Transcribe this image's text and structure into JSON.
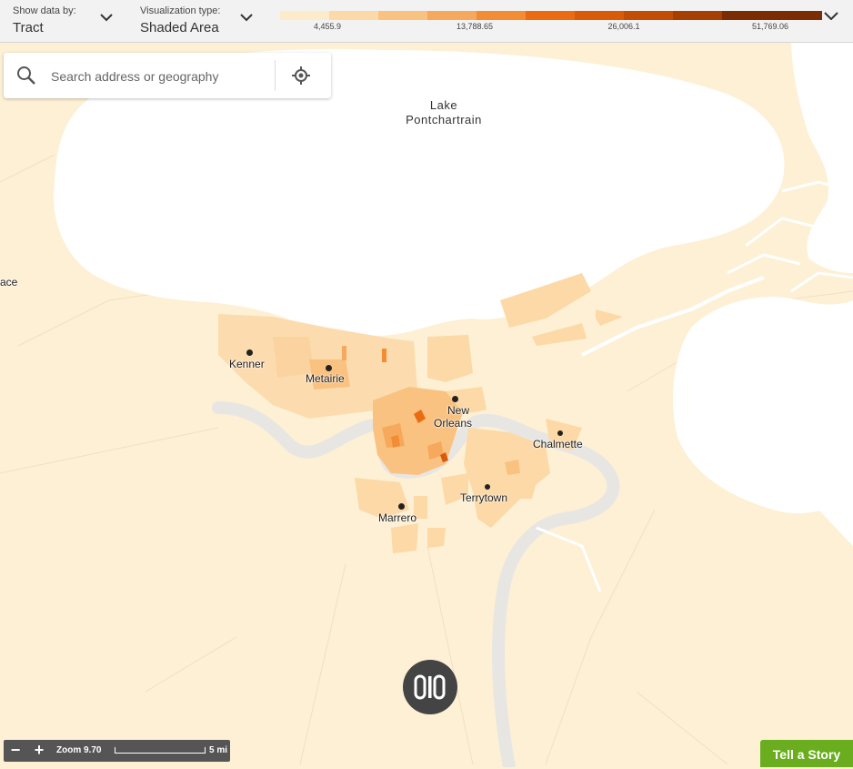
{
  "toolbar": {
    "show_data_label": "Show data by:",
    "show_data_value": "Tract",
    "viz_label": "Visualization type:",
    "viz_value": "Shaded Area"
  },
  "legend": {
    "colors": [
      "#fdebcc",
      "#fcd9a6",
      "#f9c280",
      "#f6a95d",
      "#f28c35",
      "#ea6b12",
      "#d95a08",
      "#c44d06",
      "#a53f04",
      "#7b2c03"
    ],
    "ticks": [
      "4,455.9",
      "13,788.65",
      "26,006.1",
      "51,769.06"
    ]
  },
  "search": {
    "placeholder": "Search address or geography",
    "search_icon": "search-icon",
    "locate_icon": "crosshair-icon"
  },
  "map": {
    "water_label": [
      "Lake",
      "Pontchartrain"
    ],
    "edge_label": "ace",
    "places": {
      "kenner": "Kenner",
      "metairie": "Metairie",
      "new_orleans": [
        "New",
        "Orleans"
      ],
      "chalmette": "Chalmette",
      "terrytown": "Terrytown",
      "marrero": "Marrero"
    },
    "colors": {
      "land": "#fdf0d5",
      "water": "#ffffff",
      "river": "#e8e6e3"
    }
  },
  "zoom": {
    "minus": "−",
    "plus": "+",
    "label": "Zoom 9.70",
    "scale": "5 mi"
  },
  "story_button": "Tell a Story"
}
